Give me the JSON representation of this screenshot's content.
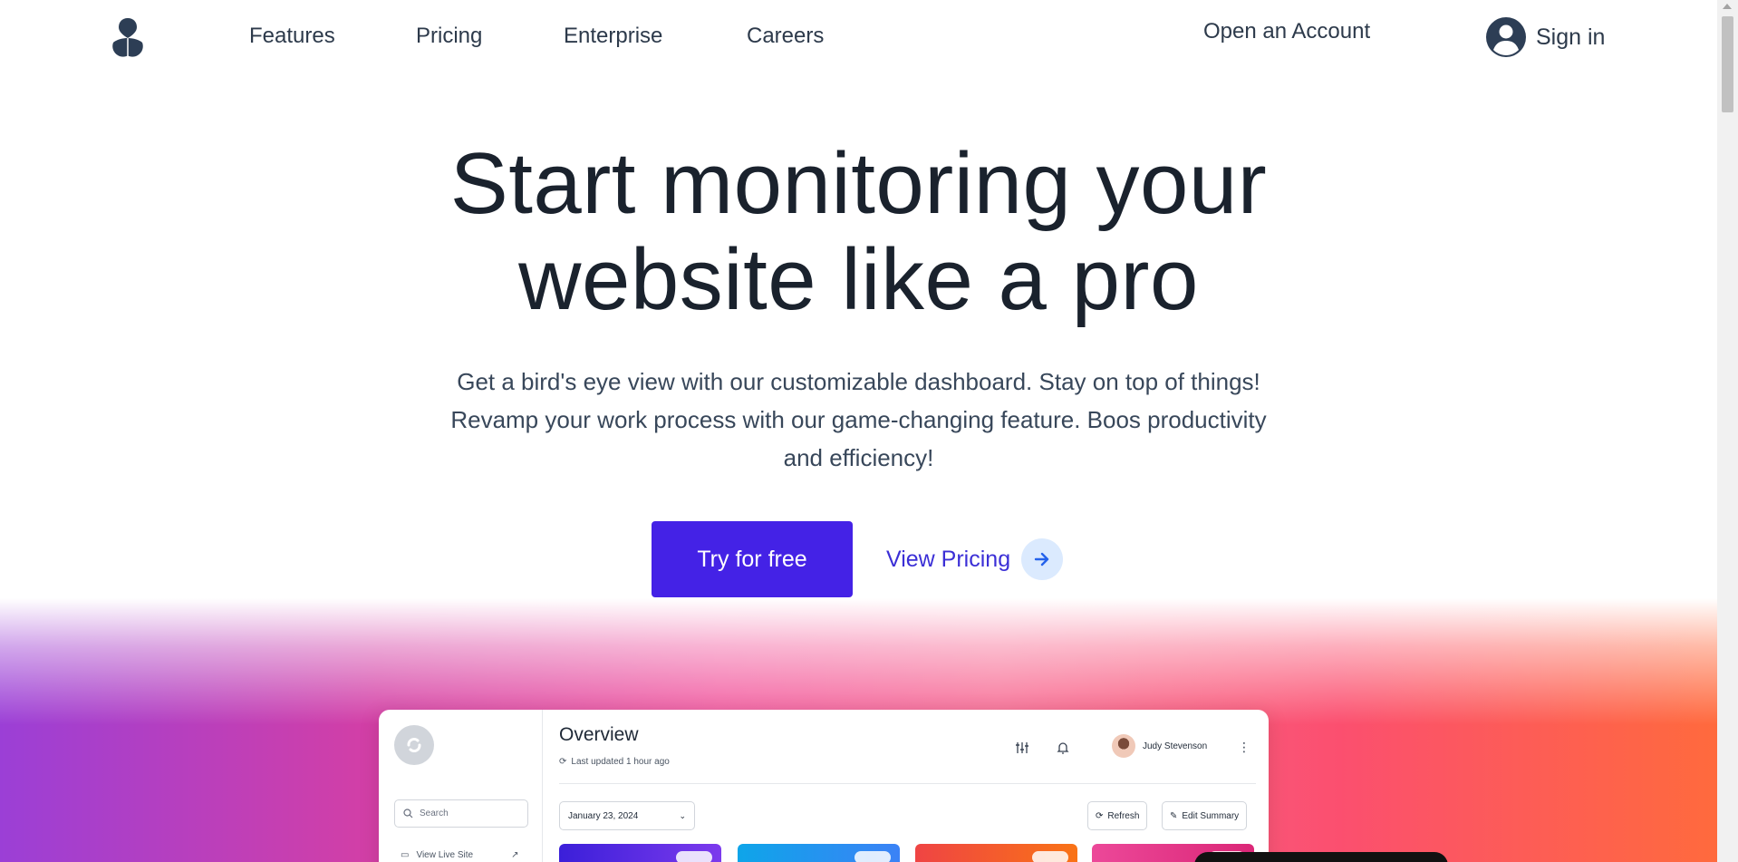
{
  "nav": {
    "logo_icon": "trefoil-logo-icon",
    "links": {
      "features": "Features",
      "pricing": "Pricing",
      "enterprise": "Enterprise",
      "careers": "Careers"
    },
    "open_account": "Open an Account",
    "sign_in": "Sign in",
    "user_icon": "user-circle-icon"
  },
  "hero": {
    "title_line1": "Start monitoring your",
    "title_line2": "website like a pro",
    "subtitle_line1": "Get a bird's eye view with our customizable dashboard. Stay on top of things!",
    "subtitle_line2": "Revamp your work process with our game-changing feature. Boos productivity",
    "subtitle_line3": "and efficiency!",
    "cta_primary": "Try for free",
    "cta_secondary": "View Pricing",
    "arrow_icon": "arrow-right-icon"
  },
  "colors": {
    "primary": "#4422e6",
    "link": "#3b2fd6",
    "heading": "#1a222d",
    "text": "#38475a"
  },
  "dashboard": {
    "title": "Overview",
    "last_updated": "Last updated 1 hour ago",
    "search_placeholder": "Search",
    "sidebar_item": "View Live Site",
    "user_name": "Judy Stevenson",
    "date": "January 23, 2024",
    "refresh": "Refresh",
    "edit_summary": "Edit Summary"
  }
}
